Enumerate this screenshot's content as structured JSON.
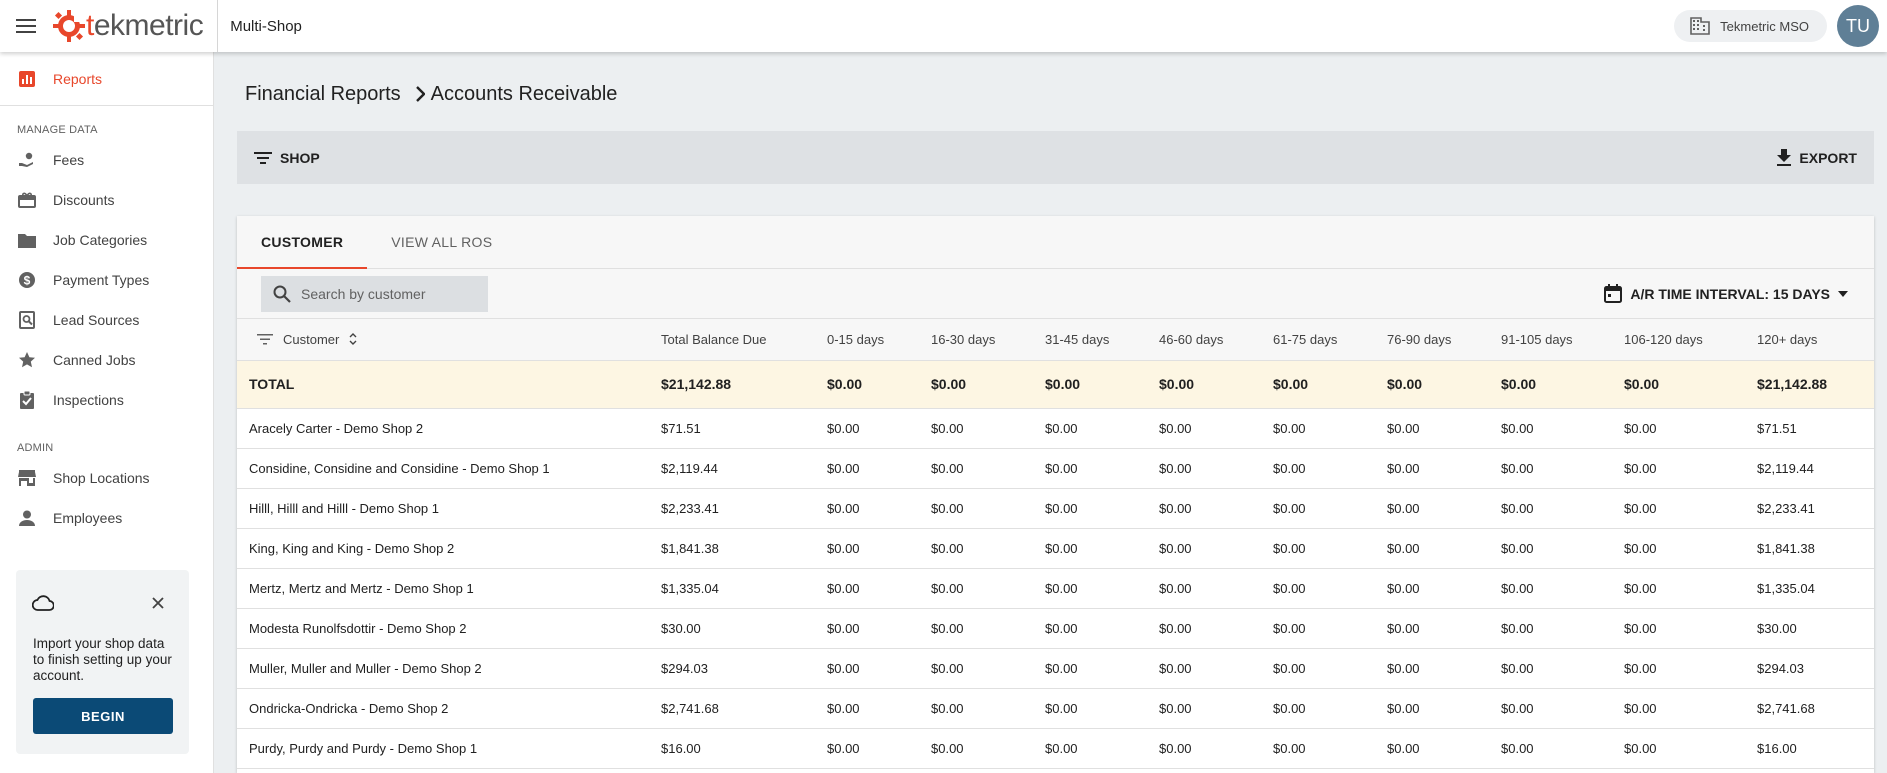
{
  "header": {
    "brand": "tekmetric",
    "brand_accent": "t",
    "brand_rest": "ekmetric",
    "app_name": "Multi-Shop",
    "org_name": "Tekmetric MSO",
    "user_initials": "TU"
  },
  "colors": {
    "accent": "#e8472b",
    "primary": "#0b4a76",
    "total_row_bg": "#fdf6e3"
  },
  "sidebar": {
    "top_items": [
      {
        "label": "Reports",
        "icon": "bar-chart-icon",
        "active": true
      }
    ],
    "manage_section": "MANAGE DATA",
    "manage_items": [
      {
        "label": "Fees",
        "icon": "hand-coin-icon"
      },
      {
        "label": "Discounts",
        "icon": "gift-icon"
      },
      {
        "label": "Job Categories",
        "icon": "folder-icon"
      },
      {
        "label": "Payment Types",
        "icon": "dollar-circle-icon"
      },
      {
        "label": "Lead Sources",
        "icon": "search-document-icon"
      },
      {
        "label": "Canned Jobs",
        "icon": "star-icon"
      },
      {
        "label": "Inspections",
        "icon": "clipboard-check-icon"
      }
    ],
    "admin_section": "ADMIN",
    "admin_items": [
      {
        "label": "Shop Locations",
        "icon": "store-icon"
      },
      {
        "label": "Employees",
        "icon": "person-icon"
      }
    ],
    "import_card": {
      "message": "Import your shop data to finish setting up your account.",
      "button": "BEGIN"
    }
  },
  "breadcrumb": {
    "parent": "Financial Reports",
    "current": "Accounts Receivable"
  },
  "filterbar": {
    "shop_label": "SHOP",
    "export_label": "EXPORT"
  },
  "tabs": [
    {
      "label": "CUSTOMER",
      "active": true
    },
    {
      "label": "VIEW ALL ROS",
      "active": false
    }
  ],
  "search": {
    "placeholder": "Search by customer"
  },
  "interval": {
    "label": "A/R TIME INTERVAL: 15 DAYS"
  },
  "table": {
    "columns": [
      "Customer",
      "Total Balance Due",
      "0-15 days",
      "16-30 days",
      "31-45 days",
      "46-60 days",
      "61-75 days",
      "76-90 days",
      "91-105 days",
      "106-120 days",
      "120+ days"
    ],
    "total_row": [
      "TOTAL",
      "$21,142.88",
      "$0.00",
      "$0.00",
      "$0.00",
      "$0.00",
      "$0.00",
      "$0.00",
      "$0.00",
      "$0.00",
      "$21,142.88"
    ],
    "rows": [
      [
        "Aracely Carter  - Demo Shop 2",
        "$71.51",
        "$0.00",
        "$0.00",
        "$0.00",
        "$0.00",
        "$0.00",
        "$0.00",
        "$0.00",
        "$0.00",
        "$71.51"
      ],
      [
        "Considine, Considine and Considine  - Demo Shop 1",
        "$2,119.44",
        "$0.00",
        "$0.00",
        "$0.00",
        "$0.00",
        "$0.00",
        "$0.00",
        "$0.00",
        "$0.00",
        "$2,119.44"
      ],
      [
        "Hilll, Hilll and Hilll  - Demo Shop 1",
        "$2,233.41",
        "$0.00",
        "$0.00",
        "$0.00",
        "$0.00",
        "$0.00",
        "$0.00",
        "$0.00",
        "$0.00",
        "$2,233.41"
      ],
      [
        "King, King and King  - Demo Shop 2",
        "$1,841.38",
        "$0.00",
        "$0.00",
        "$0.00",
        "$0.00",
        "$0.00",
        "$0.00",
        "$0.00",
        "$0.00",
        "$1,841.38"
      ],
      [
        "Mertz, Mertz and Mertz  - Demo Shop 1",
        "$1,335.04",
        "$0.00",
        "$0.00",
        "$0.00",
        "$0.00",
        "$0.00",
        "$0.00",
        "$0.00",
        "$0.00",
        "$1,335.04"
      ],
      [
        "Modesta Runolfsdottir  - Demo Shop 2",
        "$30.00",
        "$0.00",
        "$0.00",
        "$0.00",
        "$0.00",
        "$0.00",
        "$0.00",
        "$0.00",
        "$0.00",
        "$30.00"
      ],
      [
        "Muller, Muller and Muller  - Demo Shop 2",
        "$294.03",
        "$0.00",
        "$0.00",
        "$0.00",
        "$0.00",
        "$0.00",
        "$0.00",
        "$0.00",
        "$0.00",
        "$294.03"
      ],
      [
        "Ondricka-Ondricka  - Demo Shop 2",
        "$2,741.68",
        "$0.00",
        "$0.00",
        "$0.00",
        "$0.00",
        "$0.00",
        "$0.00",
        "$0.00",
        "$0.00",
        "$2,741.68"
      ],
      [
        "Purdy, Purdy and Purdy  - Demo Shop 1",
        "$16.00",
        "$0.00",
        "$0.00",
        "$0.00",
        "$0.00",
        "$0.00",
        "$0.00",
        "$0.00",
        "$0.00",
        "$16.00"
      ]
    ]
  }
}
